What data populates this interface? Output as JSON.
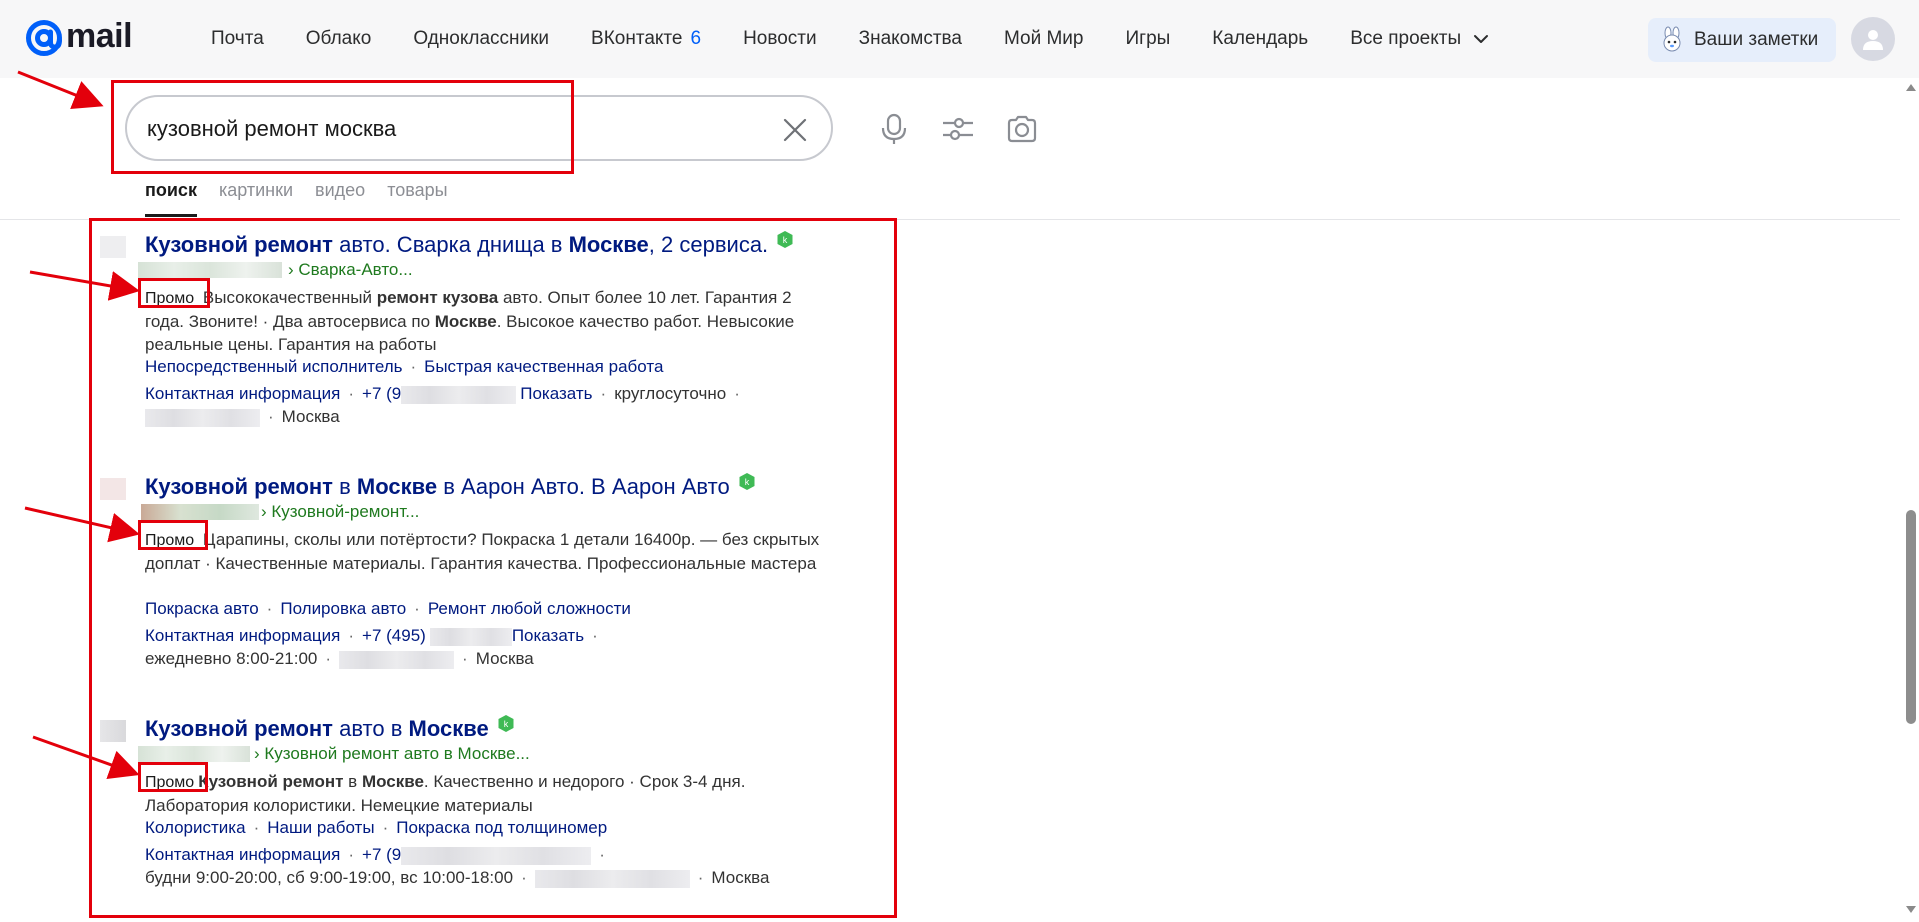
{
  "logo": {
    "text": "mail"
  },
  "nav": {
    "items": [
      "Почта",
      "Облако",
      "Одноклассники",
      "ВКонтакте",
      "Новости",
      "Знакомства",
      "Мой Мир",
      "Игры",
      "Календарь",
      "Все проекты"
    ],
    "vk_badge": "6"
  },
  "notes": {
    "label": "Ваши заметки"
  },
  "search": {
    "query": "кузовной ремонт москва"
  },
  "tabs": [
    "поиск",
    "картинки",
    "видео",
    "товары"
  ],
  "results": [
    {
      "title_b1": "Кузовной ремонт",
      "title_t1": " авто. Сварка днища в ",
      "title_b2": "Москве",
      "title_t2": ", 2 сервиса.",
      "url": "› Сварка-Авто...",
      "promo": "Промо",
      "text_t1": " Высококачественный ",
      "text_b1": "ремонт кузова",
      "text_t2": " авто. Опыт более 10 лет. Гарантия 2 года. Звоните! · Два автосервиса по ",
      "text_b2": "Москве",
      "text_t3": ". Высокое качество работ. Невысокие реальные цены. Гарантия на работы",
      "sitelinks": [
        "Непосредственный исполнитель",
        "Быстрая качественная работа"
      ],
      "contact": "Контактная информация",
      "phone": "+7 (9",
      "show": "Показать",
      "hours": "круглосуточно",
      "city": "Москва"
    },
    {
      "title_b1": "Кузовной ремонт",
      "title_t1": " в ",
      "title_b2": "Москве",
      "title_t2": " в Аарон Авто. В Аарон Авто",
      "url": "› Кузовной-ремонт...",
      "promo": "Промо",
      "text_t1": " Царапины, сколы или потёртости? Покраска 1 детали 16400р. — без скрытых доплат · Качественные материалы. Гарантия качества. Профессиональные мастера",
      "sitelinks": [
        "Покраска авто",
        "Полировка авто",
        "Ремонт любой сложности"
      ],
      "contact": "Контактная информация",
      "phone": "+7 (495)",
      "show": "Показать",
      "hours": "ежедневно 8:00-21:00",
      "city": "Москва"
    },
    {
      "title_b1": "Кузовной ремонт",
      "title_t1": " авто в ",
      "title_b2": "Москве",
      "title_t2": "",
      "url": "› Кузовной ремонт авто в Москве...",
      "promo": "Промо",
      "text_b1": "Кузовной ремонт",
      "text_t1": " в ",
      "text_b2": "Москве",
      "text_t2": ". Качественно и недорого · Срок 3-4 дня. Лаборатория колористики. Немецкие материалы",
      "sitelinks": [
        "Колористика",
        "Наши работы",
        "Покраска под толщиномер"
      ],
      "contact": "Контактная информация",
      "phone": "+7 (9",
      "hours": "будни 9:00-20:00, сб 9:00-19:00, вс 10:00-18:00",
      "city": "Москва"
    }
  ],
  "colors": {
    "link": "#001a80",
    "url": "#1f7a1f",
    "annotation": "#e3000b",
    "accent": "#005ff9"
  }
}
